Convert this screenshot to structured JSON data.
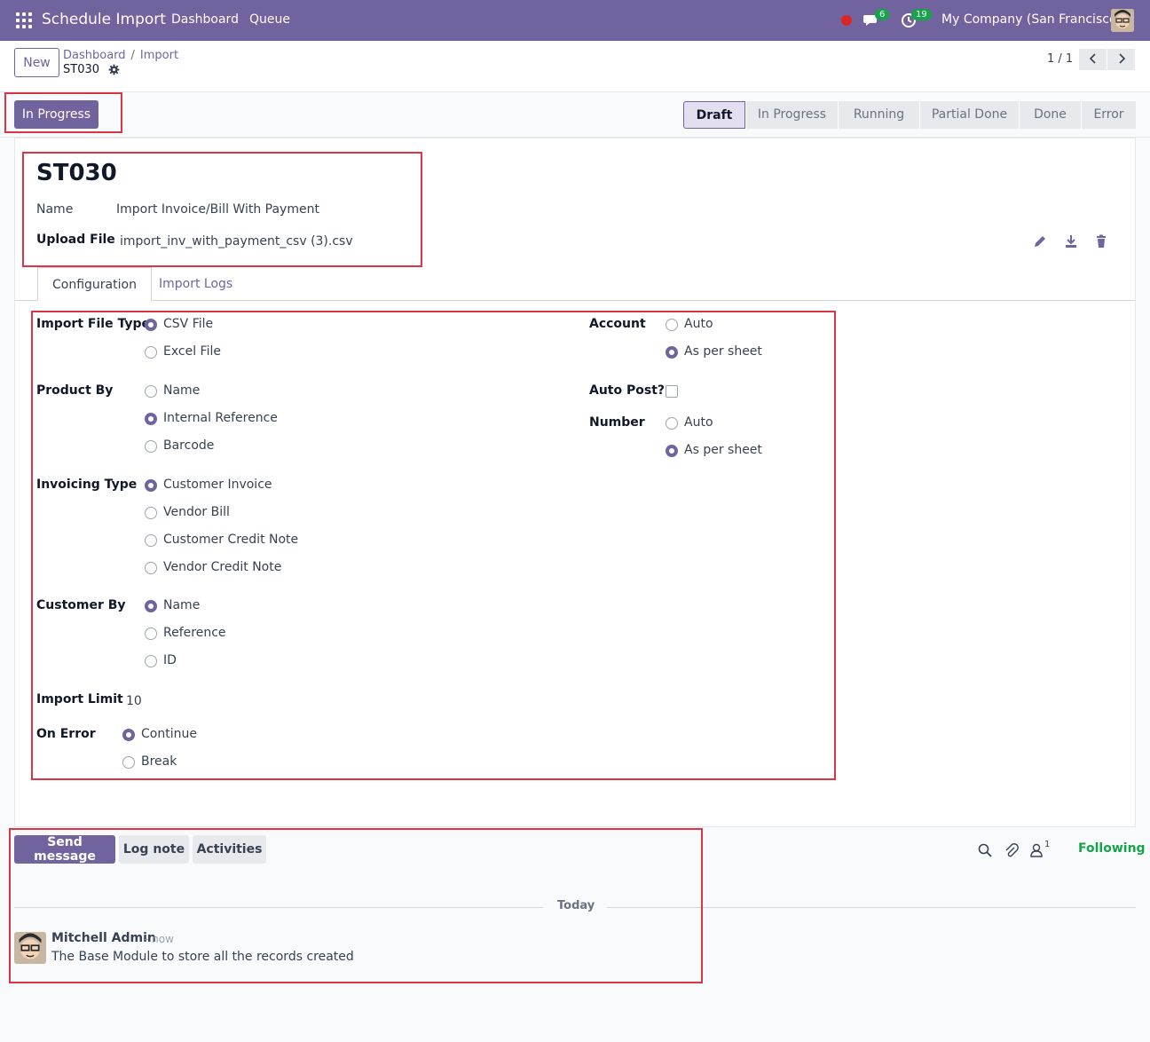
{
  "topbar": {
    "app_name": "Schedule Import",
    "menu": [
      "Dashboard",
      "Queue"
    ],
    "messages_badge": "6",
    "activities_badge": "19",
    "company": "My Company (San Francisco)"
  },
  "control_panel": {
    "new_label": "New",
    "breadcrumb": [
      "Dashboard",
      "Import"
    ],
    "record_name": "ST030",
    "pager": "1 / 1"
  },
  "statusbar": {
    "action_label": "In Progress",
    "stages": [
      "Draft",
      "In Progress",
      "Running",
      "Partial Done",
      "Done",
      "Error"
    ],
    "active_stage": "Draft"
  },
  "form": {
    "title": "ST030",
    "name_label": "Name",
    "name_value": "Import Invoice/Bill With Payment",
    "upload_label": "Upload File",
    "upload_value": "import_inv_with_payment_csv (3).csv",
    "tabs": [
      "Configuration",
      "Import Logs"
    ],
    "fields": {
      "import_file_type": {
        "label": "Import File Type",
        "options": [
          "CSV File",
          "Excel File"
        ],
        "selected": "CSV File"
      },
      "product_by": {
        "label": "Product By",
        "options": [
          "Name",
          "Internal Reference",
          "Barcode"
        ],
        "selected": "Internal Reference"
      },
      "invoicing_type": {
        "label": "Invoicing Type",
        "options": [
          "Customer Invoice",
          "Vendor Bill",
          "Customer Credit Note",
          "Vendor Credit Note"
        ],
        "selected": "Customer Invoice"
      },
      "customer_by": {
        "label": "Customer By",
        "options": [
          "Name",
          "Reference",
          "ID"
        ],
        "selected": "Name"
      },
      "import_limit": {
        "label": "Import Limit",
        "value": "10"
      },
      "on_error": {
        "label": "On Error",
        "options": [
          "Continue",
          "Break"
        ],
        "selected": "Continue"
      },
      "account": {
        "label": "Account",
        "options": [
          "Auto",
          "As per sheet"
        ],
        "selected": "As per sheet"
      },
      "auto_post": {
        "label": "Auto Post?",
        "checked": false
      },
      "number": {
        "label": "Number",
        "options": [
          "Auto",
          "As per sheet"
        ],
        "selected": "As per sheet"
      }
    }
  },
  "chatter": {
    "send_message": "Send message",
    "log_note": "Log note",
    "activities": "Activities",
    "followers_count": "1",
    "following": "Following",
    "date_separator": "Today",
    "message": {
      "author": "Mitchell Admin",
      "time": "- now",
      "body": "The Base Module to store all the records created"
    }
  },
  "colors": {
    "brand": "#71639e",
    "highlight": "#dc3545",
    "success": "#16a34a"
  }
}
